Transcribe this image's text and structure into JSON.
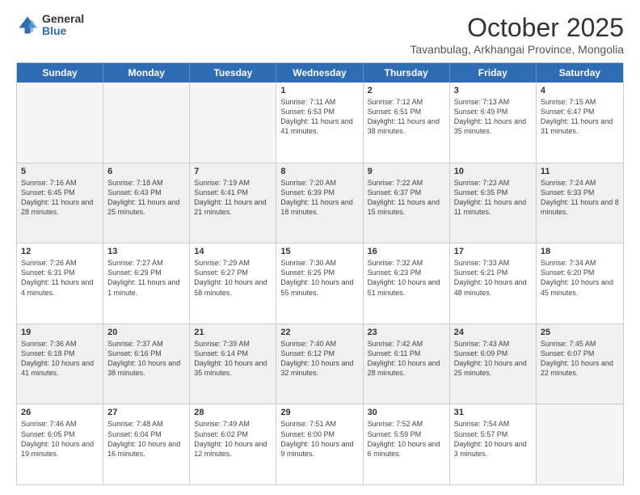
{
  "logo": {
    "general": "General",
    "blue": "Blue"
  },
  "title": "October 2025",
  "subtitle": "Tavanbulag, Arkhangai Province, Mongolia",
  "header_days": [
    "Sunday",
    "Monday",
    "Tuesday",
    "Wednesday",
    "Thursday",
    "Friday",
    "Saturday"
  ],
  "weeks": [
    [
      {
        "day": "",
        "info": "",
        "empty": true
      },
      {
        "day": "",
        "info": "",
        "empty": true
      },
      {
        "day": "",
        "info": "",
        "empty": true
      },
      {
        "day": "1",
        "info": "Sunrise: 7:11 AM\nSunset: 6:53 PM\nDaylight: 11 hours and 41 minutes."
      },
      {
        "day": "2",
        "info": "Sunrise: 7:12 AM\nSunset: 6:51 PM\nDaylight: 11 hours and 38 minutes."
      },
      {
        "day": "3",
        "info": "Sunrise: 7:13 AM\nSunset: 6:49 PM\nDaylight: 11 hours and 35 minutes."
      },
      {
        "day": "4",
        "info": "Sunrise: 7:15 AM\nSunset: 6:47 PM\nDaylight: 11 hours and 31 minutes."
      }
    ],
    [
      {
        "day": "5",
        "info": "Sunrise: 7:16 AM\nSunset: 6:45 PM\nDaylight: 11 hours and 28 minutes."
      },
      {
        "day": "6",
        "info": "Sunrise: 7:18 AM\nSunset: 6:43 PM\nDaylight: 11 hours and 25 minutes."
      },
      {
        "day": "7",
        "info": "Sunrise: 7:19 AM\nSunset: 6:41 PM\nDaylight: 11 hours and 21 minutes."
      },
      {
        "day": "8",
        "info": "Sunrise: 7:20 AM\nSunset: 6:39 PM\nDaylight: 11 hours and 18 minutes."
      },
      {
        "day": "9",
        "info": "Sunrise: 7:22 AM\nSunset: 6:37 PM\nDaylight: 11 hours and 15 minutes."
      },
      {
        "day": "10",
        "info": "Sunrise: 7:23 AM\nSunset: 6:35 PM\nDaylight: 11 hours and 11 minutes."
      },
      {
        "day": "11",
        "info": "Sunrise: 7:24 AM\nSunset: 6:33 PM\nDaylight: 11 hours and 8 minutes."
      }
    ],
    [
      {
        "day": "12",
        "info": "Sunrise: 7:26 AM\nSunset: 6:31 PM\nDaylight: 11 hours and 4 minutes."
      },
      {
        "day": "13",
        "info": "Sunrise: 7:27 AM\nSunset: 6:29 PM\nDaylight: 11 hours and 1 minute."
      },
      {
        "day": "14",
        "info": "Sunrise: 7:29 AM\nSunset: 6:27 PM\nDaylight: 10 hours and 58 minutes."
      },
      {
        "day": "15",
        "info": "Sunrise: 7:30 AM\nSunset: 6:25 PM\nDaylight: 10 hours and 55 minutes."
      },
      {
        "day": "16",
        "info": "Sunrise: 7:32 AM\nSunset: 6:23 PM\nDaylight: 10 hours and 51 minutes."
      },
      {
        "day": "17",
        "info": "Sunrise: 7:33 AM\nSunset: 6:21 PM\nDaylight: 10 hours and 48 minutes."
      },
      {
        "day": "18",
        "info": "Sunrise: 7:34 AM\nSunset: 6:20 PM\nDaylight: 10 hours and 45 minutes."
      }
    ],
    [
      {
        "day": "19",
        "info": "Sunrise: 7:36 AM\nSunset: 6:18 PM\nDaylight: 10 hours and 41 minutes."
      },
      {
        "day": "20",
        "info": "Sunrise: 7:37 AM\nSunset: 6:16 PM\nDaylight: 10 hours and 38 minutes."
      },
      {
        "day": "21",
        "info": "Sunrise: 7:39 AM\nSunset: 6:14 PM\nDaylight: 10 hours and 35 minutes."
      },
      {
        "day": "22",
        "info": "Sunrise: 7:40 AM\nSunset: 6:12 PM\nDaylight: 10 hours and 32 minutes."
      },
      {
        "day": "23",
        "info": "Sunrise: 7:42 AM\nSunset: 6:11 PM\nDaylight: 10 hours and 28 minutes."
      },
      {
        "day": "24",
        "info": "Sunrise: 7:43 AM\nSunset: 6:09 PM\nDaylight: 10 hours and 25 minutes."
      },
      {
        "day": "25",
        "info": "Sunrise: 7:45 AM\nSunset: 6:07 PM\nDaylight: 10 hours and 22 minutes."
      }
    ],
    [
      {
        "day": "26",
        "info": "Sunrise: 7:46 AM\nSunset: 6:05 PM\nDaylight: 10 hours and 19 minutes."
      },
      {
        "day": "27",
        "info": "Sunrise: 7:48 AM\nSunset: 6:04 PM\nDaylight: 10 hours and 16 minutes."
      },
      {
        "day": "28",
        "info": "Sunrise: 7:49 AM\nSunset: 6:02 PM\nDaylight: 10 hours and 12 minutes."
      },
      {
        "day": "29",
        "info": "Sunrise: 7:51 AM\nSunset: 6:00 PM\nDaylight: 10 hours and 9 minutes."
      },
      {
        "day": "30",
        "info": "Sunrise: 7:52 AM\nSunset: 5:59 PM\nDaylight: 10 hours and 6 minutes."
      },
      {
        "day": "31",
        "info": "Sunrise: 7:54 AM\nSunset: 5:57 PM\nDaylight: 10 hours and 3 minutes."
      },
      {
        "day": "",
        "info": "",
        "empty": true
      }
    ]
  ]
}
